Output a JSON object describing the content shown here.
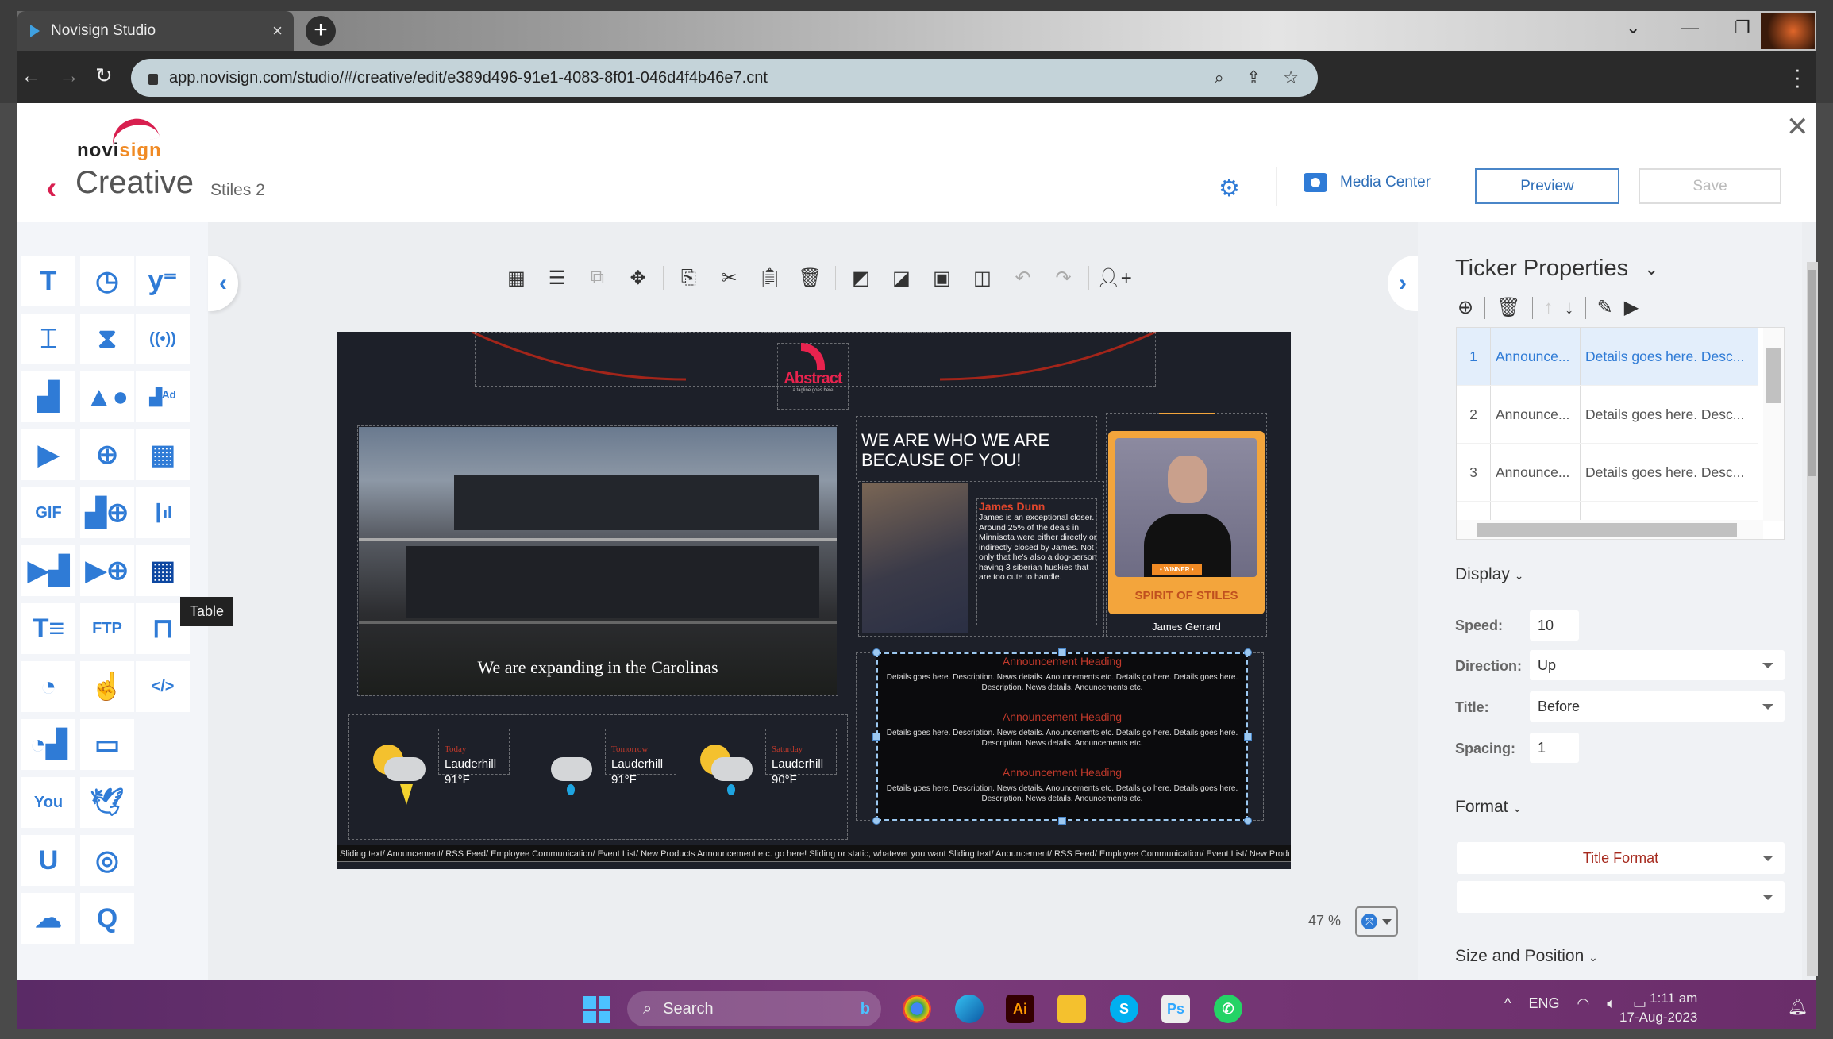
{
  "browser": {
    "tab_title": "Novisign Studio",
    "url": "app.novisign.com/studio/#/creative/edit/e389d496-91e1-4083-8f01-046d4f4b46e7.cnt"
  },
  "header": {
    "brand_a": "novi",
    "brand_b": "sign",
    "page_title": "Creative",
    "creative_name": "Stiles 2",
    "media_center_label": "Media Center",
    "preview_label": "Preview",
    "save_label": "Save"
  },
  "tools": [
    {
      "name": "text",
      "glyph": "T"
    },
    {
      "name": "clock",
      "glyph": "◷"
    },
    {
      "name": "yammer",
      "glyph": "y⁼"
    },
    {
      "name": "text-box",
      "glyph": "⌶"
    },
    {
      "name": "timer",
      "glyph": "⧗"
    },
    {
      "name": "live",
      "glyph": "((•))"
    },
    {
      "name": "image",
      "glyph": "▟"
    },
    {
      "name": "shapes",
      "glyph": "▲●"
    },
    {
      "name": "ad-image",
      "glyph": "▟ᴬᵈ"
    },
    {
      "name": "video",
      "glyph": "▶"
    },
    {
      "name": "web",
      "glyph": "⊕"
    },
    {
      "name": "calendar",
      "glyph": "▦"
    },
    {
      "name": "gif",
      "glyph": "GIF"
    },
    {
      "name": "web-image",
      "glyph": "▟⊕"
    },
    {
      "name": "chart",
      "glyph": "┃ıl"
    },
    {
      "name": "media-playlist",
      "glyph": "▶▟"
    },
    {
      "name": "web-video",
      "glyph": "▶⊕"
    },
    {
      "name": "table",
      "glyph": "▦"
    },
    {
      "name": "ticker",
      "glyph": "T≡"
    },
    {
      "name": "ftp",
      "glyph": "FTP"
    },
    {
      "name": "barrier",
      "glyph": "⊓"
    },
    {
      "name": "rss",
      "glyph": "◔"
    },
    {
      "name": "touch",
      "glyph": "☝"
    },
    {
      "name": "html-code",
      "glyph": "</>"
    },
    {
      "name": "rss-media",
      "glyph": "◔▟"
    },
    {
      "name": "screen",
      "glyph": "▭"
    },
    {
      "name": "youtube",
      "glyph": "You"
    },
    {
      "name": "twitter",
      "glyph": "🕊"
    },
    {
      "name": "u-widget",
      "glyph": "U"
    },
    {
      "name": "instagram",
      "glyph": "◎"
    },
    {
      "name": "weather",
      "glyph": "☁"
    },
    {
      "name": "queue",
      "glyph": "Q"
    }
  ],
  "tooltip": "Table",
  "canvas": {
    "building_caption": "We are expanding in the Carolinas",
    "headline": "WE ARE WHO WE ARE BECAUSE OF YOU!",
    "logo_text": "Abstract",
    "logo_tagline": "a tagline goes here",
    "profile_name": "James Dunn",
    "profile_bio": "James is an exceptional closer. Around 25% of the deals in Minnisota were either directly or indirectly closed by James. Not only that he's also a dog-person having 3 siberian huskies that are too cute to handle.",
    "award_badge": "• WINNER •",
    "award_title": "SPIRIT OF STILES",
    "award_person": "James Gerrard",
    "announcements": [
      {
        "heading": "Announcement Heading",
        "details": "Details goes here. Description. News details. Anouncements etc. Details go here. Details goes here. Description. News details. Anouncements etc."
      },
      {
        "heading": "Announcement Heading",
        "details": "Details goes here. Description. News details. Anouncements etc. Details go here. Details goes here. Description. News details. Anouncements etc."
      },
      {
        "heading": "Announcement Heading",
        "details": "Details goes here. Description. News details. Anouncements etc. Details go here. Details goes here. Description. News details. Anouncements etc."
      }
    ],
    "weather": [
      {
        "day": "Today",
        "city": "Lauderhill",
        "temp": "91°F",
        "condition": "thunderstorm"
      },
      {
        "day": "Tomorrow",
        "city": "Lauderhill",
        "temp": "91°F",
        "condition": "rain"
      },
      {
        "day": "Saturday",
        "city": "Lauderhill",
        "temp": "90°F",
        "condition": "partly-cloudy-rain"
      }
    ],
    "ticker_text": "Sliding text/ Anouncement/ RSS Feed/ Employee Communication/ Event List/ New Products Announcement etc. go here! Sliding or static, whatever you want          Sliding text/ Anouncement/ RSS Feed/ Employee Communication/ Event List/ New Products Announcement etc. go here!"
  },
  "zoom": {
    "value": "47 %"
  },
  "props": {
    "title": "Ticker Properties",
    "rows": [
      {
        "n": "1",
        "title": "Announce...",
        "details": "Details goes here. Desc..."
      },
      {
        "n": "2",
        "title": "Announce...",
        "details": "Details goes here. Desc..."
      },
      {
        "n": "3",
        "title": "Announce...",
        "details": "Details goes here. Desc..."
      }
    ],
    "display_label": "Display",
    "speed_label": "Speed:",
    "speed_value": "10",
    "direction_label": "Direction:",
    "direction_value": "Up",
    "title_label": "Title:",
    "title_value": "Before",
    "spacing_label": "Spacing:",
    "spacing_value": "1",
    "format_label": "Format",
    "title_format_label": "Title Format",
    "second_format_value": "",
    "size_position_label": "Size and Position"
  },
  "taskbar": {
    "search_label": "Search",
    "lang": "ENG",
    "time": "1:11 am",
    "date": "17-Aug-2023"
  }
}
